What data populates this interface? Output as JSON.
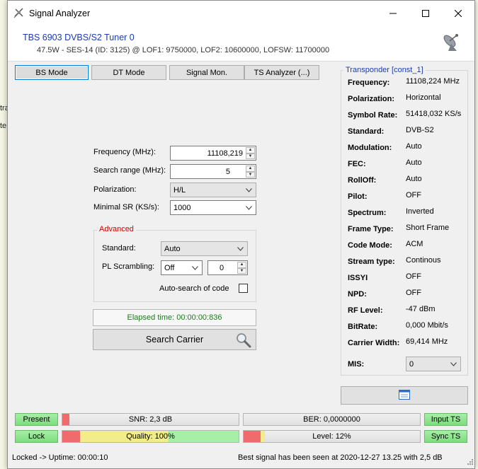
{
  "window": {
    "title": "Signal Analyzer"
  },
  "device": {
    "title": "TBS 6903 DVBS/S2 Tuner 0",
    "subtitle": "47.5W - SES-14 (ID: 3125) @ LOF1: 9750000, LOF2: 10600000, LOFSW: 11700000"
  },
  "background": {
    "frag1": "tra",
    "frag2": "te"
  },
  "tabs": [
    {
      "label": "BS Mode",
      "active": true
    },
    {
      "label": "DT Mode",
      "active": false
    },
    {
      "label": "Signal Mon.",
      "active": false
    },
    {
      "label": "TS Analyzer (...)",
      "active": false
    }
  ],
  "form": {
    "frequency_label": "Frequency (MHz):",
    "frequency_value": "11108,219",
    "search_range_label": "Search range (MHz):",
    "search_range_value": "5",
    "polarization_label": "Polarization:",
    "polarization_value": "H/L",
    "minimal_sr_label": "Minimal SR (KS/s):",
    "minimal_sr_value": "1000"
  },
  "advanced": {
    "title": "Advanced",
    "standard_label": "Standard:",
    "standard_value": "Auto",
    "pl_label": "PL Scrambling:",
    "pl_mode_value": "Off",
    "pl_number_value": "0",
    "autosearch_label": "Auto-search of code",
    "autosearch_checked": false
  },
  "elapsed": {
    "label": "Elapsed time: 00:00:00:836"
  },
  "search_button": {
    "label": "Search Carrier"
  },
  "transponder": {
    "title": "Transponder [const_1]",
    "rows": [
      {
        "label": "Frequency:",
        "value": "11108,224 MHz"
      },
      {
        "label": "Polarization:",
        "value": "Horizontal"
      },
      {
        "label": "Symbol Rate:",
        "value": "51418,032 KS/s"
      },
      {
        "label": "Standard:",
        "value": "DVB-S2"
      },
      {
        "label": "Modulation:",
        "value": "Auto"
      },
      {
        "label": "FEC:",
        "value": "Auto"
      },
      {
        "label": "RollOff:",
        "value": "Auto"
      },
      {
        "label": "Pilot:",
        "value": "OFF"
      },
      {
        "label": "Spectrum:",
        "value": "Inverted"
      },
      {
        "label": "Frame Type:",
        "value": "Short Frame"
      },
      {
        "label": "Code Mode:",
        "value": "ACM"
      },
      {
        "label": "Stream type:",
        "value": "Continous"
      },
      {
        "label": "ISSYI",
        "value": "OFF"
      },
      {
        "label": "NPD:",
        "value": "OFF"
      },
      {
        "label": "RF Level:",
        "value": "-47 dBm"
      },
      {
        "label": "BitRate:",
        "value": "0,000 Mbit/s"
      },
      {
        "label": "Carrier Width:",
        "value": "69,414 MHz"
      }
    ],
    "mis_label": "MIS:",
    "mis_value": "0"
  },
  "indicators": {
    "present": "Present",
    "lock": "Lock",
    "input_ts": "Input TS",
    "sync_ts": "Sync TS",
    "snr": {
      "label": "SNR: 2,3 dB",
      "level": 0.04
    },
    "ber": {
      "label": "BER: 0,0000000",
      "level": 0
    },
    "quality": {
      "label": "Quality: 100%",
      "level": 1.0
    },
    "level": {
      "label": "Level: 12%",
      "level": 0.12
    }
  },
  "statusbar": {
    "left": "Locked -> Uptime: 00:00:10",
    "right": "Best signal has been seen at 2020-12-27 13.25 with 2,5 dB"
  },
  "colors": {
    "accent_blue": "#1a3bb0",
    "advanced_red": "#d40000",
    "elapsed_green": "#1d7a1d",
    "status_green": "#7ddc7d",
    "bar_red": "#f06b6b",
    "bar_yellow": "#f2ec8a"
  }
}
